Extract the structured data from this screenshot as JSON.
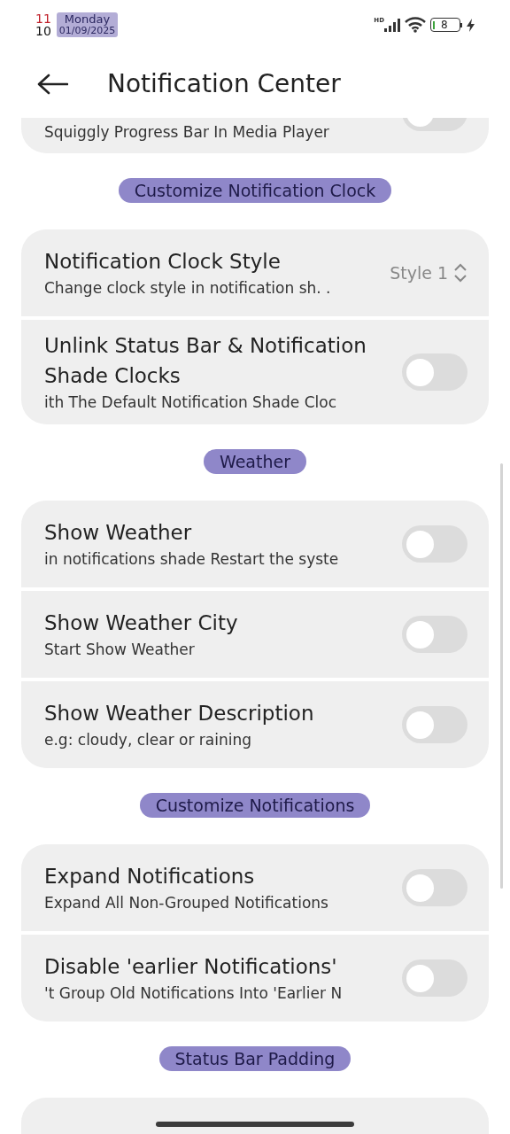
{
  "status_bar": {
    "hour": "11",
    "minute": "10",
    "day": "Monday",
    "date": "01/09/2025",
    "battery": "8",
    "network_label": "HD"
  },
  "header": {
    "title": "Notification Center"
  },
  "sections": [
    {
      "partial": true,
      "rows": [
        {
          "kind": "toggle",
          "subtitle": "Squiggly Progress Bar In Media Player",
          "on": false
        }
      ]
    },
    {
      "title": "Customize Notification Clock",
      "rows": [
        {
          "kind": "select",
          "title": "Notification Clock Style",
          "subtitle": "Change clock style in notification sh. .",
          "value": "Style 1"
        },
        {
          "kind": "toggle",
          "title": "Unlink Status Bar & Notification Shade Clocks",
          "subtitle": "ith The Default Notification Shade Cloc",
          "on": false
        }
      ]
    },
    {
      "title": "Weather",
      "rows": [
        {
          "kind": "toggle",
          "title": "Show Weather",
          "subtitle": "in notifications shade Restart the syste",
          "on": false
        },
        {
          "kind": "toggle",
          "title": "Show Weather City",
          "subtitle": "Start Show Weather",
          "on": false
        },
        {
          "kind": "toggle",
          "title": "Show Weather Description",
          "subtitle": "e.g: cloudy, clear or raining",
          "on": false
        }
      ]
    },
    {
      "title": "Customize Notifications",
      "rows": [
        {
          "kind": "toggle",
          "title": "Expand Notifications",
          "subtitle": "Expand All Non-Grouped Notifications",
          "on": false
        },
        {
          "kind": "toggle",
          "title": "Disable 'earlier Notifications'",
          "subtitle": "'t Group Old Notifications Into 'Earlier N",
          "on": false
        }
      ]
    },
    {
      "title": "Status Bar Padding"
    }
  ]
}
